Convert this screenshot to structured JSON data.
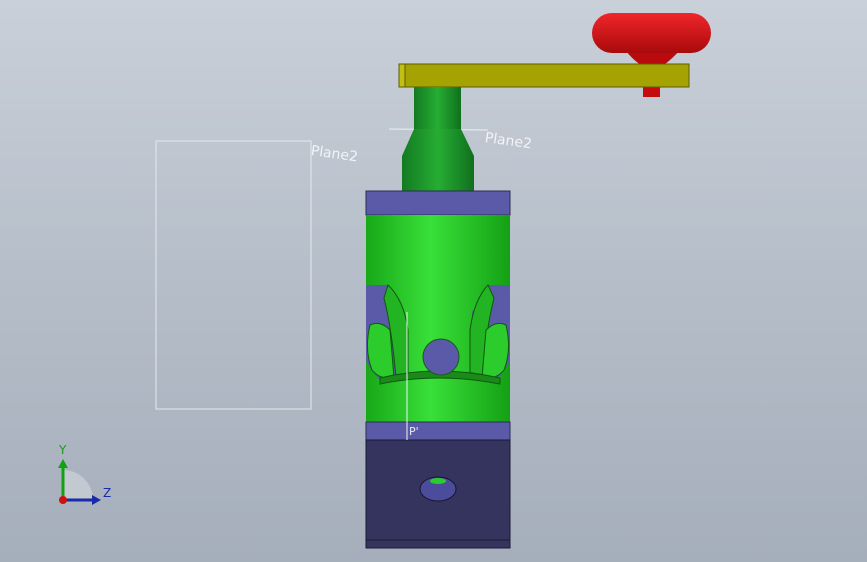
{
  "viewport": {
    "planes": [
      {
        "label": "Plane2"
      },
      {
        "label": "Plane2"
      }
    ],
    "point_label": "P'",
    "triad": {
      "y_label": "Y",
      "z_label": "Z"
    }
  },
  "colors": {
    "background_top": "#c9d0d9",
    "body_green": "#1fbf1f",
    "shaft_green": "#1d8f2a",
    "bands_purple": "#5a5aa6",
    "base_navy": "#34345f",
    "lever_yellow": "#a3a100",
    "knob_red": "#d80f12"
  },
  "icons": {
    "triad": "axis-triad-icon"
  }
}
